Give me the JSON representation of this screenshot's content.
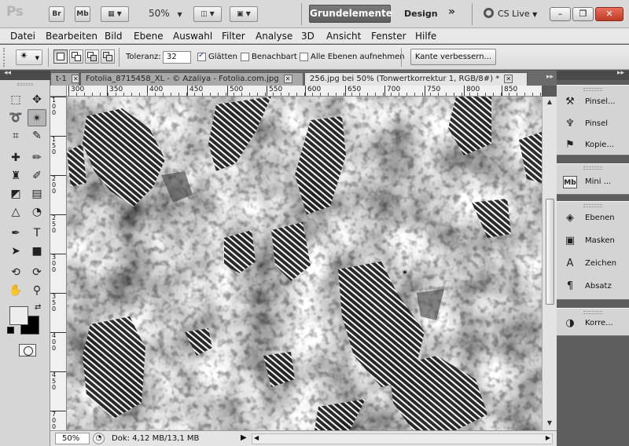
{
  "app": {
    "logo": "Ps",
    "bridge_label": "Br",
    "minibridge_label": "Mb",
    "zoom_display": "50%",
    "workspace_active": "Grundelemente",
    "workspace_other": "Design",
    "workspace_more": "»",
    "cslive_label": "CS Live",
    "win_min": "–",
    "win_restore": "❐",
    "win_close": "✕"
  },
  "menu": {
    "items": [
      "Datei",
      "Bearbeiten",
      "Bild",
      "Ebene",
      "Auswahl",
      "Filter",
      "Analyse",
      "3D",
      "Ansicht",
      "Fenster",
      "Hilfe"
    ]
  },
  "options": {
    "tool_icon": "magic-wand-icon",
    "tolerance_label": "Toleranz:",
    "tolerance_value": "32",
    "antialias_label": "Glätten",
    "antialias_checked": true,
    "contiguous_label": "Benachbart",
    "contiguous_checked": false,
    "all_layers_label": "Alle Ebenen aufnehmen",
    "all_layers_checked": false,
    "refine_edge_label": "Kante verbessern..."
  },
  "tabs": [
    {
      "label": "t-1",
      "active": false
    },
    {
      "label": "Fotolia_8715458_XL - © Azaliya - Fotolia.com.jpg",
      "active": false
    },
    {
      "label": "256.jpg bei 50% (Tonwertkorrektur 1, RGB/8#) *",
      "active": true
    }
  ],
  "ruler": {
    "h_labels": [
      "300",
      "350",
      "400",
      "450",
      "500",
      "550",
      "600",
      "650",
      "700",
      "750",
      "800",
      "850"
    ],
    "v_labels": [
      "1",
      "1",
      "1",
      "2",
      "2",
      "3",
      "3",
      "4",
      "4",
      "5",
      "5",
      "6",
      "6",
      "7",
      "7"
    ]
  },
  "status": {
    "zoom": "50%",
    "doc_info": "Dok: 4,12 MB/13,1 MB"
  },
  "panels": {
    "group1": [
      {
        "label": "Pinsel...",
        "icon": "brush-presets-icon"
      },
      {
        "label": "Pinsel",
        "icon": "brush-icon"
      },
      {
        "label": "Kopie...",
        "icon": "clone-source-icon"
      }
    ],
    "group2": [
      {
        "label": "Mini ...",
        "icon": "mini-bridge-icon"
      }
    ],
    "group3": [
      {
        "label": "Ebenen",
        "icon": "layers-icon"
      },
      {
        "label": "Masken",
        "icon": "masks-icon"
      },
      {
        "label": "Zeichen",
        "icon": "character-icon"
      },
      {
        "label": "Absatz",
        "icon": "paragraph-icon"
      }
    ],
    "group4": [
      {
        "label": "Korre...",
        "icon": "adjustments-icon"
      }
    ]
  },
  "colors": {
    "foreground": "#ededed",
    "background": "#000000",
    "workspace_active_bg": "#666666",
    "close_button": "#c8442e"
  }
}
